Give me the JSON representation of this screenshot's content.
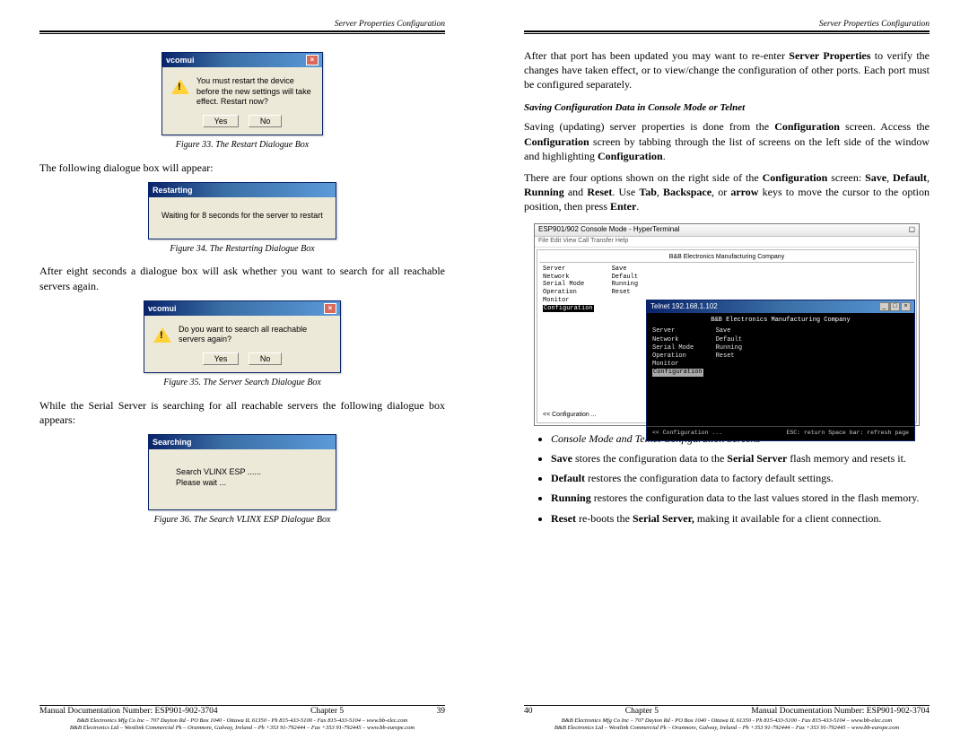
{
  "left": {
    "header": "Server Properties Configuration",
    "fig33": {
      "dialog_title": "vcomui",
      "msg": "You must restart the device before the new settings will take effect. Restart now?",
      "yes": "Yes",
      "no": "No",
      "caption": "Figure 33.    The Restart Dialogue Box"
    },
    "p1": "The following dialogue box will appear:",
    "fig34": {
      "dialog_title": "Restarting",
      "msg": "Waiting for 8 seconds for the server to restart",
      "caption": "Figure 34.    The Restarting Dialogue Box"
    },
    "p2": "After eight seconds a dialogue box will ask whether you want to search for all reachable servers again.",
    "fig35": {
      "dialog_title": "vcomui",
      "msg": "Do you want to search all reachable servers again?",
      "yes": "Yes",
      "no": "No",
      "caption": "Figure 35.    The Server Search Dialogue Box"
    },
    "p3": "While the Serial Server is searching for all reachable servers the following dialogue box appears:",
    "fig36": {
      "dialog_title": "Searching",
      "line1": "Search VLINX ESP ......",
      "line2": "Please wait ...",
      "caption": "Figure 36.    The Search VLINX ESP Dialogue Box"
    },
    "footer": {
      "docnum": "Manual Documentation Number: ESP901-902-3704",
      "chapter": "Chapter 5",
      "page": "39",
      "fine1": "B&B Electronics Mfg Co Inc – 707 Dayton Rd - PO Box 1040 - Ottawa IL 61350 - Ph 815-433-5100 - Fax 815-433-5104 – www.bb-elec.com",
      "fine2": "B&B Electronics Ltd – Westlink Commercial Pk – Oranmore, Galway, Ireland – Ph +353 91-792444 – Fax +353 91-792445 – www.bb-europe.com"
    }
  },
  "right": {
    "header": "Server Properties Configuration",
    "p1_a": "After that port has been updated you may want to re-enter ",
    "p1_b1": "Server Properties",
    "p1_c": " to verify the changes have taken effect, or to view/change the configuration  of other ports. Each port must be configured separately.",
    "h2": "Saving Configuration Data in Console Mode or Telnet",
    "p2_a": "Saving (updating) server properties is done from the ",
    "p2_b": "Configuration",
    "p2_c": " screen. Access the ",
    "p2_d": "Configuration",
    "p2_e": " screen by tabbing through the list of screens on the left side of the window and highlighting ",
    "p2_f": "Configuration",
    "p2_g": ".",
    "p3_a": "There are four options shown on the right side of the ",
    "p3_b": "Configuration",
    "p3_c": " screen: ",
    "p3_d": "Save",
    "p3_e": ", ",
    "p3_f": "Default",
    "p3_g": ", ",
    "p3_h": "Running",
    "p3_i": " and ",
    "p3_j": "Reset",
    "p3_k": ". Use ",
    "p3_l": "Tab",
    "p3_m": ", ",
    "p3_n": "Backspace",
    "p3_o": ", or ",
    "p3_p": "arrow",
    "p3_q": " keys to move the cursor to the option position, then press ",
    "p3_r": "Enter",
    "p3_s": ".",
    "console": {
      "win_title": "ESP901/902 Console Mode - HyperTerminal",
      "company": "B&B Electronics Manufacturing Company",
      "left_items": [
        "Server",
        "Network",
        "Serial Mode",
        "Operation",
        "Monitor"
      ],
      "left_hi": "Configuration",
      "right_items": [
        "Save",
        "Default",
        "Running",
        "Reset"
      ],
      "scroll_hint": "<< Configuration ...",
      "telnet_title": "Telnet 192.168.1.102",
      "telnet_company": "B&B Electronics Manufacturing Company",
      "telnet_left": [
        "Server",
        "Network",
        "Serial Mode",
        "Operation",
        "Monitor"
      ],
      "telnet_hi": "Configuration",
      "telnet_right": [
        "Save",
        "Default",
        "Running",
        "Reset"
      ],
      "telnet_footer_left": "<< Configuration ...",
      "telnet_footer_right": "ESC: return   Space bar: refresh page"
    },
    "bullet_caption": "Console Mode and Telnet Configuration Screens",
    "bullets": {
      "b1a": "Save",
      "b1b": " stores the configuration data to the ",
      "b1c": "Serial Server",
      "b1d": " flash memory and resets it.",
      "b2a": "Default",
      "b2b": " restores the configuration data to factory default settings.",
      "b3a": "Running",
      "b3b": " restores the configuration data to the last values stored in the flash memory.",
      "b4a": "Reset",
      "b4b": " re-boots the ",
      "b4c": "Serial Server,",
      "b4d": " making it available for a client connection."
    },
    "footer": {
      "page": "40",
      "chapter": "Chapter 5",
      "docnum": "Manual Documentation Number: ESP901-902-3704",
      "fine1": "B&B Electronics Mfg Co Inc – 707 Dayton Rd - PO Box 1040 - Ottawa IL 61350 - Ph 815-433-5100 - Fax 815-433-5104 – www.bb-elec.com",
      "fine2": "B&B Electronics Ltd – Westlink Commercial Pk – Oranmore, Galway, Ireland – Ph +353 91-792444 – Fax +353 91-792445 – www.bb-europe.com"
    }
  }
}
